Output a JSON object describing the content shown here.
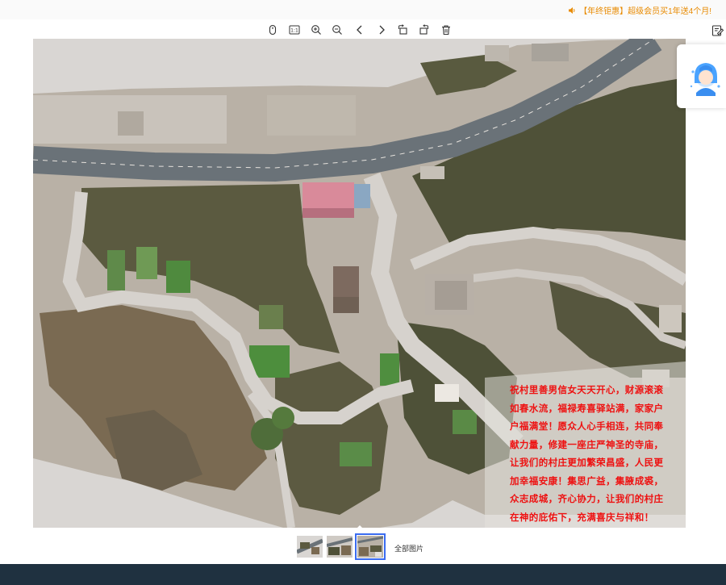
{
  "promo": {
    "text": "【年终钜惠】超级会员买1年送4个月!",
    "accent": "#e88a00"
  },
  "toolbar": {
    "buttons": [
      {
        "name": "mouse-mode-button",
        "icon": "mouse-icon"
      },
      {
        "name": "actual-size-button",
        "icon": "one-to-one-icon",
        "label": "1:1"
      },
      {
        "name": "zoom-in-button",
        "icon": "zoom-in-icon"
      },
      {
        "name": "zoom-out-button",
        "icon": "zoom-out-icon"
      },
      {
        "name": "previous-button",
        "icon": "chevron-left-icon"
      },
      {
        "name": "next-button",
        "icon": "chevron-right-icon"
      },
      {
        "name": "rotate-left-button",
        "icon": "rotate-left-icon"
      },
      {
        "name": "rotate-right-button",
        "icon": "rotate-right-icon"
      },
      {
        "name": "delete-button",
        "icon": "trash-icon"
      }
    ],
    "edit_icon": "edit-note-icon"
  },
  "image": {
    "blessing_lines": [
      "祝村里善男信女天天开心，财源滚滚",
      "如春水流，福禄寿喜驿站满，家家户",
      "户福满堂！愿众人心手相连，共同奉",
      "献力量，修建一座庄严神圣的寺庙，",
      "让我们的村庄更加繁荣昌盛，人民更",
      "加幸福安康！集思广益，集腋成裘，",
      "众志成城，齐心协力，让我们的村庄",
      "在神的庇佑下，充满喜庆与祥和！"
    ],
    "text_color": "#ee1111"
  },
  "thumbnails": {
    "items": [
      "thumbnail-1",
      "thumbnail-2",
      "thumbnail-3"
    ],
    "active_index": 2,
    "all_label": "全部图片"
  },
  "colors": {
    "footer": "#1f3140",
    "active_outline": "#3b6cf0"
  }
}
